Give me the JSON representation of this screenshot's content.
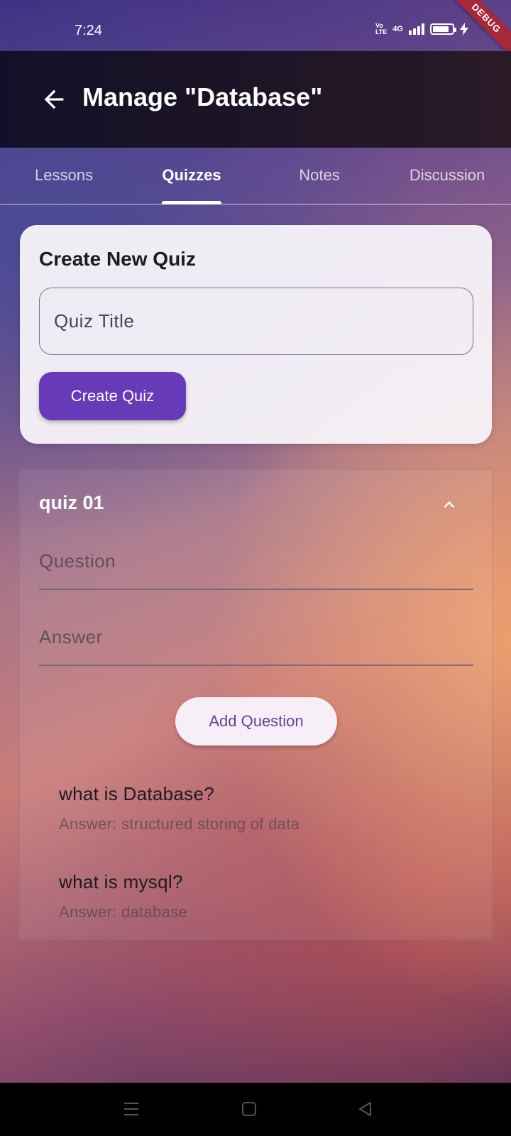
{
  "status_bar": {
    "time": "7:24",
    "volte_line1": "Vo",
    "volte_line2": "LTE",
    "network": "4G",
    "battery_level": 0.85,
    "debug_label": "DEBUG"
  },
  "app_bar": {
    "title": "Manage \"Database\"",
    "back_icon": "arrow-left-icon"
  },
  "tabs": [
    {
      "label": "Lessons",
      "active": false
    },
    {
      "label": "Quizzes",
      "active": true
    },
    {
      "label": "Notes",
      "active": false
    },
    {
      "label": "Discussion",
      "active": false
    }
  ],
  "create_quiz": {
    "title": "Create New Quiz",
    "input_placeholder": "Quiz Title",
    "input_value": "",
    "button_label": "Create Quiz"
  },
  "quiz": {
    "name": "quiz 01",
    "expanded": true,
    "question_placeholder": "Question",
    "answer_placeholder": "Answer",
    "add_button_label": "Add Question",
    "questions": [
      {
        "question": "what is Database?",
        "answer": "Answer: structured storing of data"
      },
      {
        "question": "what is mysql?",
        "answer": "Answer: database"
      }
    ]
  },
  "colors": {
    "primary": "#673ab7",
    "app_bar": "#1c1526",
    "debug_banner": "#a6283a"
  }
}
